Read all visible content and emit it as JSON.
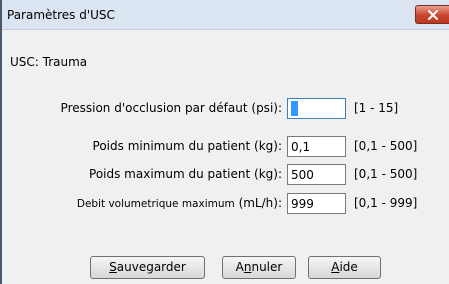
{
  "window": {
    "title": "Paramètres d'USC",
    "close_icon": "close-icon",
    "close_color": "#c8452c"
  },
  "usc_label": "USC: Trauma",
  "fields": [
    {
      "label": "Pression d'occlusion par défaut (psi):",
      "value": "3",
      "range": "[1 - 15]"
    },
    {
      "label": "Poids minimum du patient (kg):",
      "value": "0,1",
      "range": "[0,1 - 500]"
    },
    {
      "label": "Poids maximum du patient (kg):",
      "value": "500",
      "range": "[0,1 - 500]"
    },
    {
      "label": "Debit volumetrique maximum",
      "unit": "(mL/h):",
      "value": "999",
      "range": "[0,1 - 999]"
    }
  ],
  "buttons": {
    "save": {
      "mnemonic": "S",
      "rest": "auvegarder"
    },
    "cancel": {
      "pre": "A",
      "mnemonic": "n",
      "rest": "nuler"
    },
    "help": {
      "mnemonic": "A",
      "rest": "ide"
    }
  }
}
